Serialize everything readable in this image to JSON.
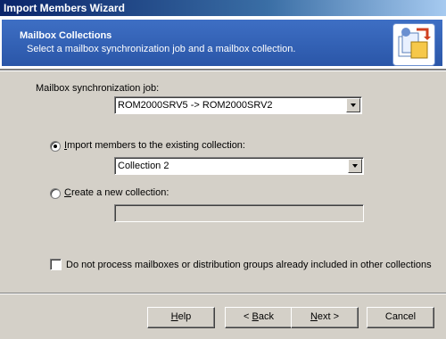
{
  "window": {
    "title": "Import Members Wizard"
  },
  "header": {
    "title": "Mailbox Collections",
    "subtitle": "Select a mailbox synchronization job and a mailbox collection.",
    "icon": "wizard-collections-icon"
  },
  "sync_job": {
    "label": "Mailbox synchronization job:",
    "value": "ROM2000SRV5 -> ROM2000SRV2"
  },
  "import_existing": {
    "label_first": "I",
    "label_rest": "mport members to the existing collection:",
    "checked": true,
    "collection": "Collection 2"
  },
  "create_new": {
    "label_first": "C",
    "label_rest": "reate a new collection:",
    "checked": false,
    "name": ""
  },
  "option": {
    "label": "Do not process mailboxes or distribution groups already included in other collections",
    "checked": false
  },
  "buttons": {
    "help_u": "H",
    "help_rest": "elp",
    "back_pre": "< ",
    "back_u": "B",
    "back_rest": "ack",
    "next_u": "N",
    "next_rest": "ext >",
    "cancel": "Cancel"
  }
}
